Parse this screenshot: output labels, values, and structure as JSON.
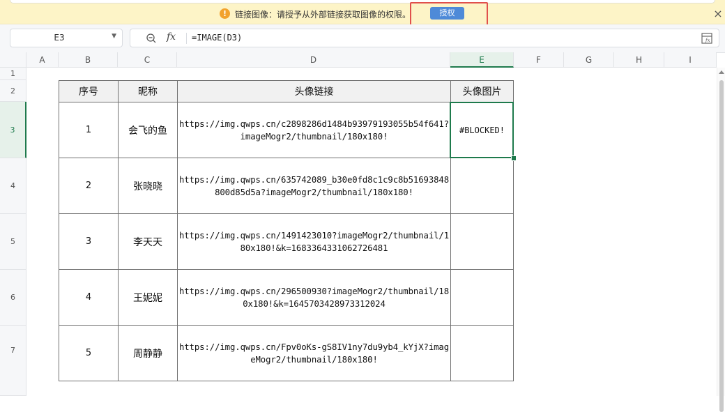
{
  "notification": {
    "warning_icon": "!",
    "message": "链接图像：请授予从外部链接获取图像的权限。",
    "authorize_label": "授权",
    "close_label": "×"
  },
  "formula_bar": {
    "name_box": "E3",
    "fx_label": "fx",
    "formula": "=IMAGE(D3)"
  },
  "columns": [
    "A",
    "B",
    "C",
    "D",
    "E",
    "F",
    "G",
    "H",
    "I"
  ],
  "rows": [
    "1",
    "2",
    "3",
    "4",
    "5",
    "6",
    "7"
  ],
  "table": {
    "headers": [
      "序号",
      "昵称",
      "头像链接",
      "头像图片"
    ],
    "records": [
      {
        "no": "1",
        "nickname": "会飞的鱼",
        "url": "https://img.qwps.cn/c2898286d1484b93979193055b54f641?imageMogr2/thumbnail/180x180!",
        "image": "#BLOCKED!"
      },
      {
        "no": "2",
        "nickname": "张晓晓",
        "url": "https://img.qwps.cn/635742089_b30e0fd8c1c9c8b51693848800d85d5a?imageMogr2/thumbnail/180x180!",
        "image": ""
      },
      {
        "no": "3",
        "nickname": "李天天",
        "url": "https://img.qwps.cn/1491423010?imageMogr2/thumbnail/180x180!&k=1683364331062726481",
        "image": ""
      },
      {
        "no": "4",
        "nickname": "王妮妮",
        "url": "https://img.qwps.cn/296500930?imageMogr2/thumbnail/180x180!&k=1645703428973312024",
        "image": ""
      },
      {
        "no": "5",
        "nickname": "周静静",
        "url": "https://img.qwps.cn/Fpv0oKs-gS8IV1ny7du9yb4_kYjX?imageMogr2/thumbnail/180x180!",
        "image": ""
      }
    ]
  },
  "colors": {
    "notice_bg": "#fdf4c7",
    "accent_green": "#1e7a4c",
    "button_blue": "#4e8ad8",
    "highlight_red": "#e0504c"
  }
}
